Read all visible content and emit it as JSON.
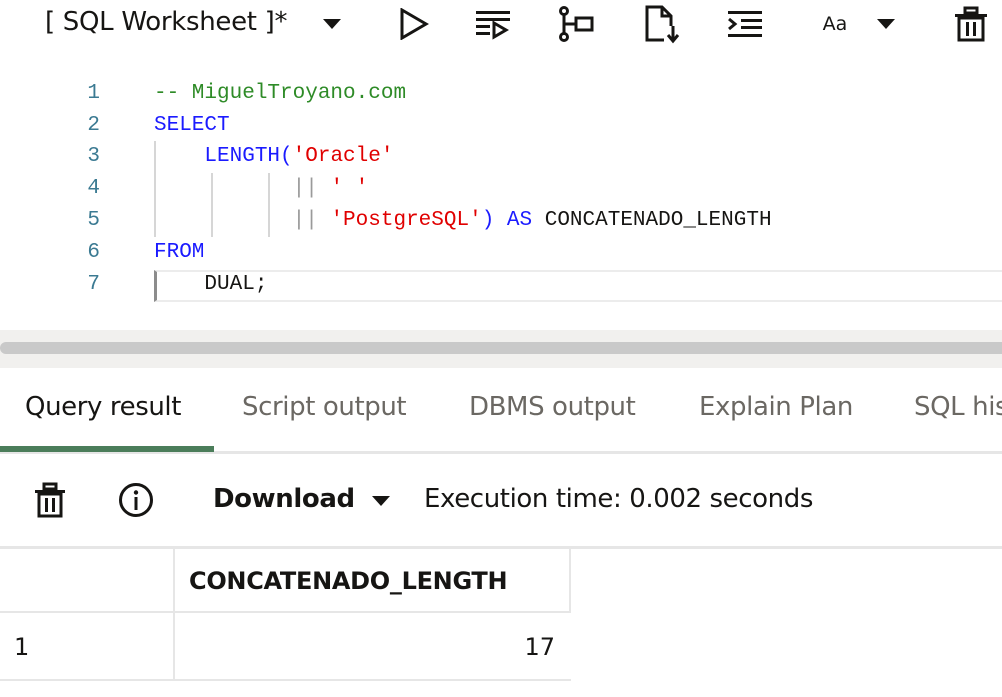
{
  "toolbar": {
    "worksheet_title": "[ SQL Worksheet ]*",
    "font_size_label": "Aa",
    "icons": [
      "run-statement-icon",
      "run-script-icon",
      "explain-plan-icon",
      "download-file-icon",
      "format-code-icon",
      "font-size-icon",
      "clear-icon"
    ]
  },
  "editor": {
    "lines": [
      {
        "num": "1",
        "tokens": [
          {
            "t": "-- MiguelTroyano.com",
            "c": "comment"
          }
        ]
      },
      {
        "num": "2",
        "tokens": [
          {
            "t": "SELECT",
            "c": "kw"
          }
        ]
      },
      {
        "num": "3",
        "tokens": [
          {
            "t": "    ",
            "c": "plain"
          },
          {
            "t": "LENGTH(",
            "c": "kw"
          },
          {
            "t": "'Oracle'",
            "c": "str"
          }
        ]
      },
      {
        "num": "4",
        "tokens": [
          {
            "t": "           ",
            "c": "plain"
          },
          {
            "t": "||",
            "c": "op"
          },
          {
            "t": " ",
            "c": "plain"
          },
          {
            "t": "' '",
            "c": "str"
          }
        ]
      },
      {
        "num": "5",
        "tokens": [
          {
            "t": "           ",
            "c": "plain"
          },
          {
            "t": "||",
            "c": "op"
          },
          {
            "t": " ",
            "c": "plain"
          },
          {
            "t": "'PostgreSQL'",
            "c": "str"
          },
          {
            "t": ") AS",
            "c": "kw"
          },
          {
            "t": " CONCATENADO_LENGTH",
            "c": "plain"
          }
        ]
      },
      {
        "num": "6",
        "tokens": [
          {
            "t": "FROM",
            "c": "kw"
          }
        ]
      },
      {
        "num": "7",
        "tokens": [
          {
            "t": "    ",
            "c": "plain"
          },
          {
            "t": "DUAL;",
            "c": "plain"
          }
        ]
      }
    ]
  },
  "tabs": [
    {
      "label": "Query result",
      "active": true
    },
    {
      "label": "Script output",
      "active": false
    },
    {
      "label": "DBMS output",
      "active": false
    },
    {
      "label": "Explain Plan",
      "active": false
    },
    {
      "label": "SQL history",
      "active": false
    }
  ],
  "results_toolbar": {
    "download_label": "Download",
    "execution_time": "Execution time: 0.002 seconds"
  },
  "grid": {
    "columns": [
      "CONCATENADO_LENGTH"
    ],
    "rows": [
      {
        "row_num": "1",
        "values": [
          "17"
        ]
      }
    ]
  },
  "colors": {
    "active_tab_underline": "#4b7d5a",
    "comment": "#2e8b27",
    "keyword": "#1b1bff",
    "string": "#e00000",
    "line_number": "#3b7a92"
  }
}
